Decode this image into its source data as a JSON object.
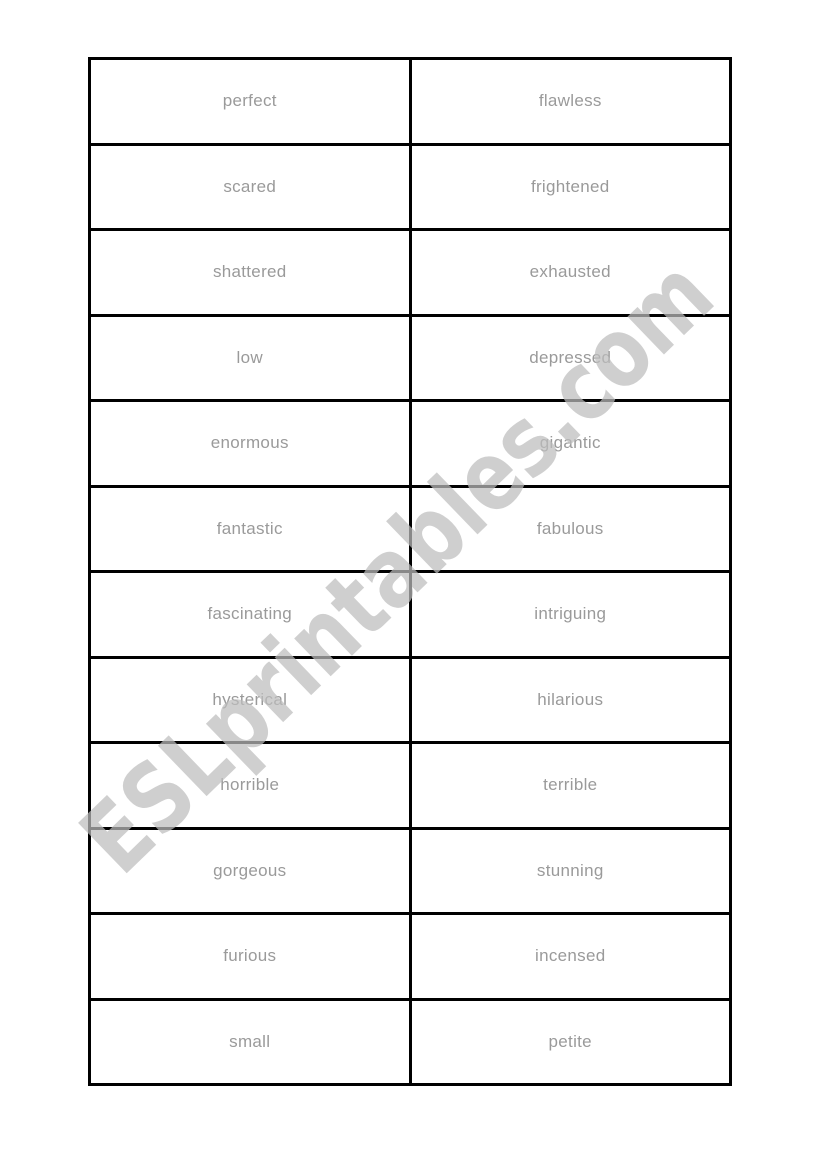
{
  "document": {
    "type": "word-matching-cards",
    "pairs": [
      {
        "left": "perfect",
        "right": "flawless"
      },
      {
        "left": "scared",
        "right": "frightened"
      },
      {
        "left": "shattered",
        "right": "exhausted"
      },
      {
        "left": "low",
        "right": "depressed"
      },
      {
        "left": "enormous",
        "right": "gigantic"
      },
      {
        "left": "fantastic",
        "right": "fabulous"
      },
      {
        "left": "fascinating",
        "right": "intriguing"
      },
      {
        "left": "hysterical",
        "right": "hilarious"
      },
      {
        "left": "horrible",
        "right": "terrible"
      },
      {
        "left": "gorgeous",
        "right": "stunning"
      },
      {
        "left": "furious",
        "right": "incensed"
      },
      {
        "left": "small",
        "right": "petite"
      }
    ]
  },
  "watermark": {
    "text": "ESLprintables.com"
  },
  "colors": {
    "text": "#9a9a9a",
    "border": "#000000",
    "watermark": "#bdbdbd",
    "background": "#ffffff"
  }
}
